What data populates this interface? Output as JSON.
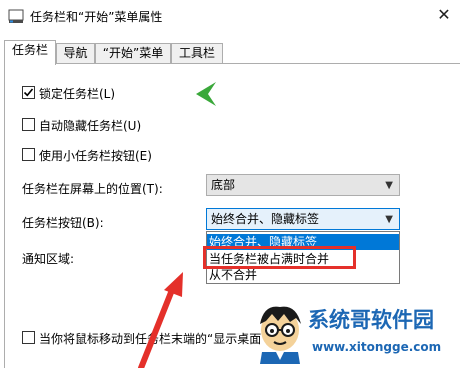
{
  "window": {
    "title": "任务栏和“开始”菜单属性",
    "close_label": "✕"
  },
  "tabs": [
    {
      "label": "任务栏",
      "active": true
    },
    {
      "label": "导航",
      "active": false
    },
    {
      "label": "“开始”菜单",
      "active": false
    },
    {
      "label": "工具栏",
      "active": false
    }
  ],
  "taskbar_tab": {
    "lock_taskbar": {
      "label": "锁定任务栏(L)",
      "checked": true
    },
    "auto_hide": {
      "label": "自动隐藏任务栏(U)",
      "checked": false
    },
    "small_buttons": {
      "label": "使用小任务栏按钮(E)",
      "checked": false
    },
    "position": {
      "label": "任务栏在屏幕上的位置(T):",
      "value": "底部"
    },
    "buttons": {
      "label": "任务栏按钮(B):",
      "value": "始终合并、隐藏标签"
    },
    "notification_label": "通知区域:",
    "peek": {
      "label": "当你将鼠标移动到任务栏末端的“显示桌面",
      "checked": false
    }
  },
  "buttons_dropdown": {
    "options": [
      {
        "label": "始终合并、隐藏标签",
        "selected": true
      },
      {
        "label": "当任务栏被占满时合并",
        "selected": false
      },
      {
        "label": "从不合并",
        "selected": false
      }
    ]
  },
  "annotation": {
    "highlight_color": "#e4302a",
    "chevron_color": "#3aa83a"
  },
  "watermark": {
    "brand": "系统哥软件园",
    "url": "www.xitongge.com"
  }
}
